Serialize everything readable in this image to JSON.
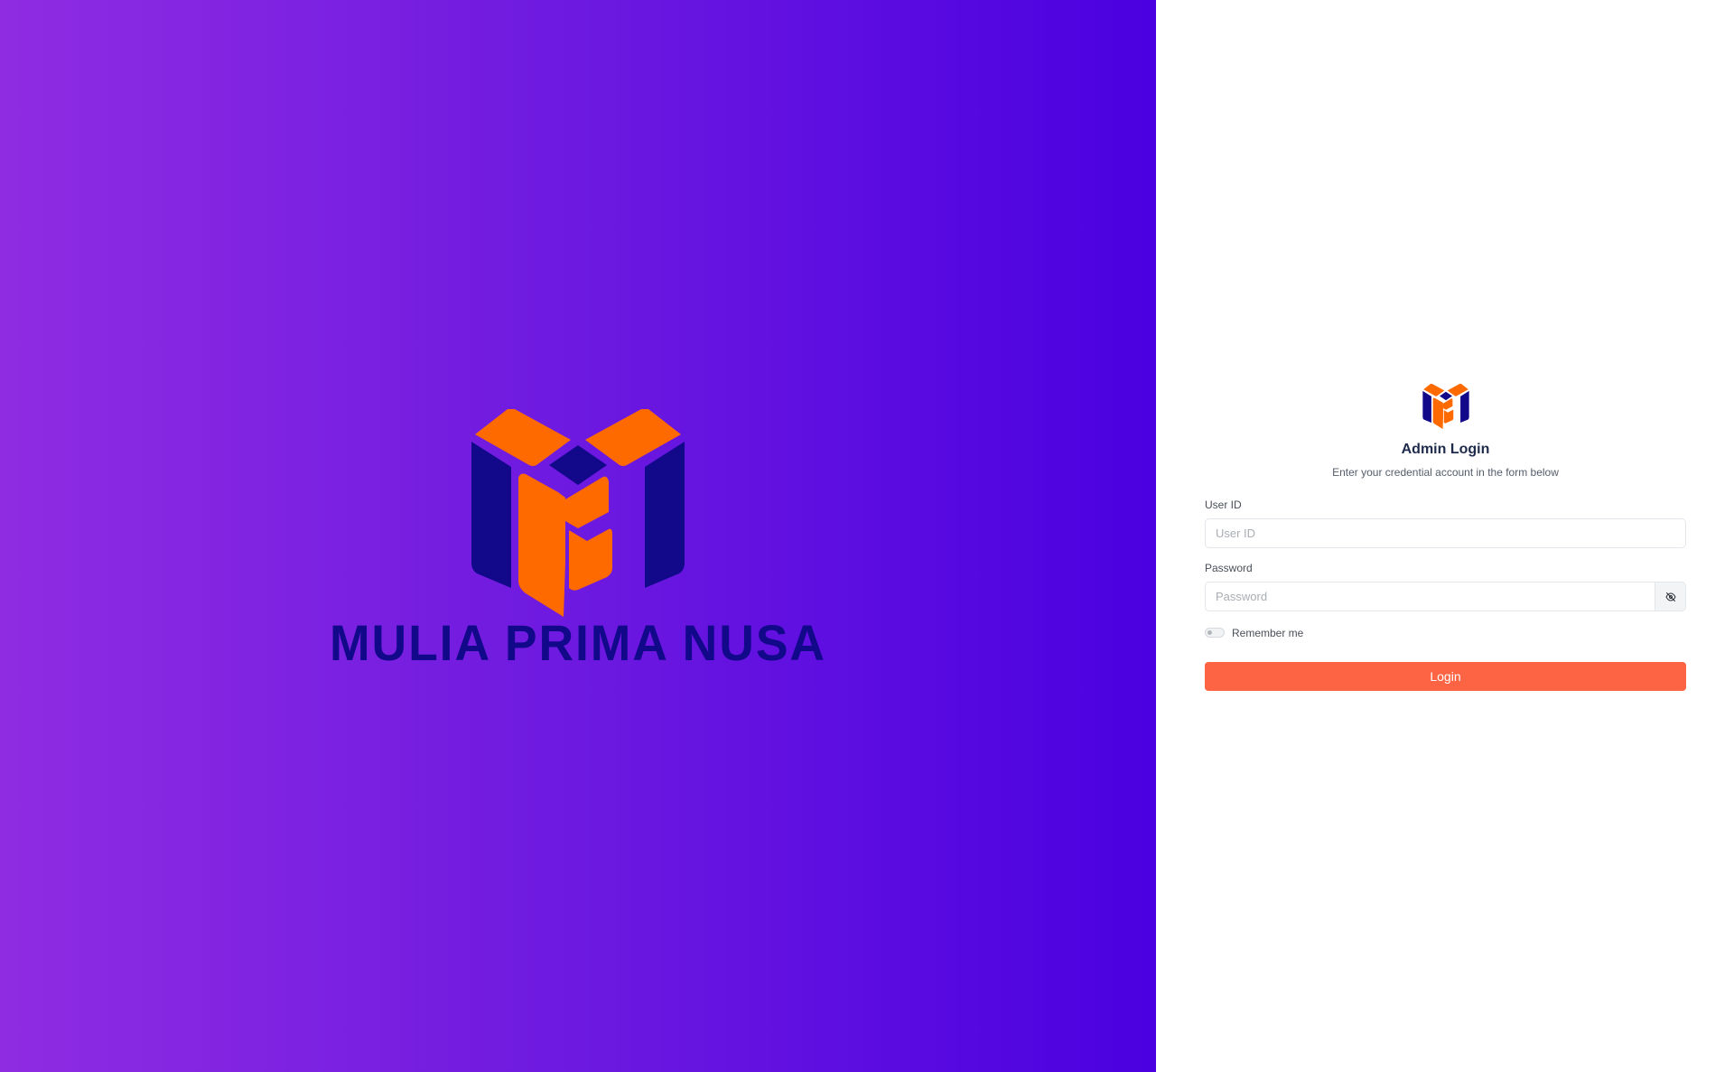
{
  "colors": {
    "gradient_start": "#8f2ce2",
    "gradient_end": "#4a00e0",
    "logo_orange": "#ff6a00",
    "logo_navy": "#12088a",
    "login_button": "#fc6443",
    "title_text": "#1e2a4a"
  },
  "brand": {
    "name": "MULIA PRIMA NUSA",
    "logo_icon": "mpn-cube-logo"
  },
  "login": {
    "logo_icon": "mpn-cube-logo",
    "title": "Admin Login",
    "subtitle": "Enter your credential account in the form below",
    "user_id": {
      "label": "User ID",
      "placeholder": "User ID",
      "value": ""
    },
    "password": {
      "label": "Password",
      "placeholder": "Password",
      "value": "",
      "toggle_icon": "eye-off-icon"
    },
    "remember": {
      "label": "Remember me",
      "checked": false
    },
    "submit_label": "Login"
  }
}
